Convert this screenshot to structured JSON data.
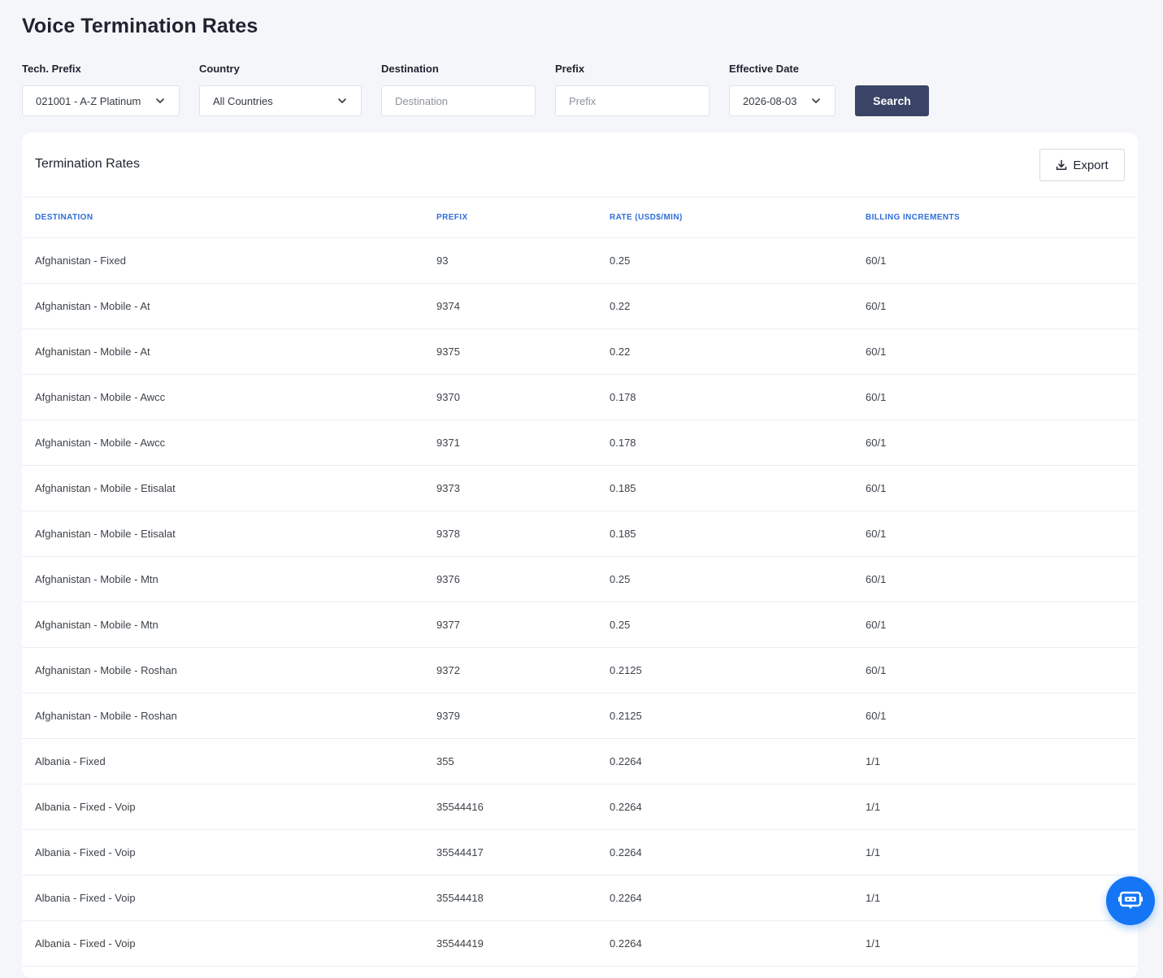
{
  "page": {
    "title": "Voice Termination Rates"
  },
  "filters": {
    "tech_prefix": {
      "label": "Tech. Prefix",
      "value": "021001 - A-Z Platinum"
    },
    "country": {
      "label": "Country",
      "value": "All Countries"
    },
    "destination": {
      "label": "Destination",
      "placeholder": "Destination"
    },
    "prefix": {
      "label": "Prefix",
      "placeholder": "Prefix"
    },
    "effective_date": {
      "label": "Effective Date",
      "value": "2026-08-03"
    },
    "search_label": "Search"
  },
  "card": {
    "title": "Termination Rates",
    "export_label": "Export"
  },
  "table": {
    "headers": [
      "Destination",
      "Prefix",
      "Rate (USD$/MIN)",
      "Billing Increments"
    ],
    "rows": [
      [
        "Afghanistan - Fixed",
        "93",
        "0.25",
        "60/1"
      ],
      [
        "Afghanistan - Mobile - At",
        "9374",
        "0.22",
        "60/1"
      ],
      [
        "Afghanistan - Mobile - At",
        "9375",
        "0.22",
        "60/1"
      ],
      [
        "Afghanistan - Mobile - Awcc",
        "9370",
        "0.178",
        "60/1"
      ],
      [
        "Afghanistan - Mobile - Awcc",
        "9371",
        "0.178",
        "60/1"
      ],
      [
        "Afghanistan - Mobile - Etisalat",
        "9373",
        "0.185",
        "60/1"
      ],
      [
        "Afghanistan - Mobile - Etisalat",
        "9378",
        "0.185",
        "60/1"
      ],
      [
        "Afghanistan - Mobile - Mtn",
        "9376",
        "0.25",
        "60/1"
      ],
      [
        "Afghanistan - Mobile - Mtn",
        "9377",
        "0.25",
        "60/1"
      ],
      [
        "Afghanistan - Mobile - Roshan",
        "9372",
        "0.2125",
        "60/1"
      ],
      [
        "Afghanistan - Mobile - Roshan",
        "9379",
        "0.2125",
        "60/1"
      ],
      [
        "Albania - Fixed",
        "355",
        "0.2264",
        "1/1"
      ],
      [
        "Albania - Fixed - Voip",
        "35544416",
        "0.2264",
        "1/1"
      ],
      [
        "Albania - Fixed - Voip",
        "35544417",
        "0.2264",
        "1/1"
      ],
      [
        "Albania - Fixed - Voip",
        "35544418",
        "0.2264",
        "1/1"
      ],
      [
        "Albania - Fixed - Voip",
        "35544419",
        "0.2264",
        "1/1"
      ]
    ]
  },
  "colors": {
    "accent": "#3a4466",
    "header_text": "#2f6ed8",
    "fab": "#1576f5",
    "background": "#f5f6f9"
  },
  "icons": {
    "dropdown": "chevron-down-icon",
    "export": "download-icon",
    "fab": "chatbot-icon"
  }
}
